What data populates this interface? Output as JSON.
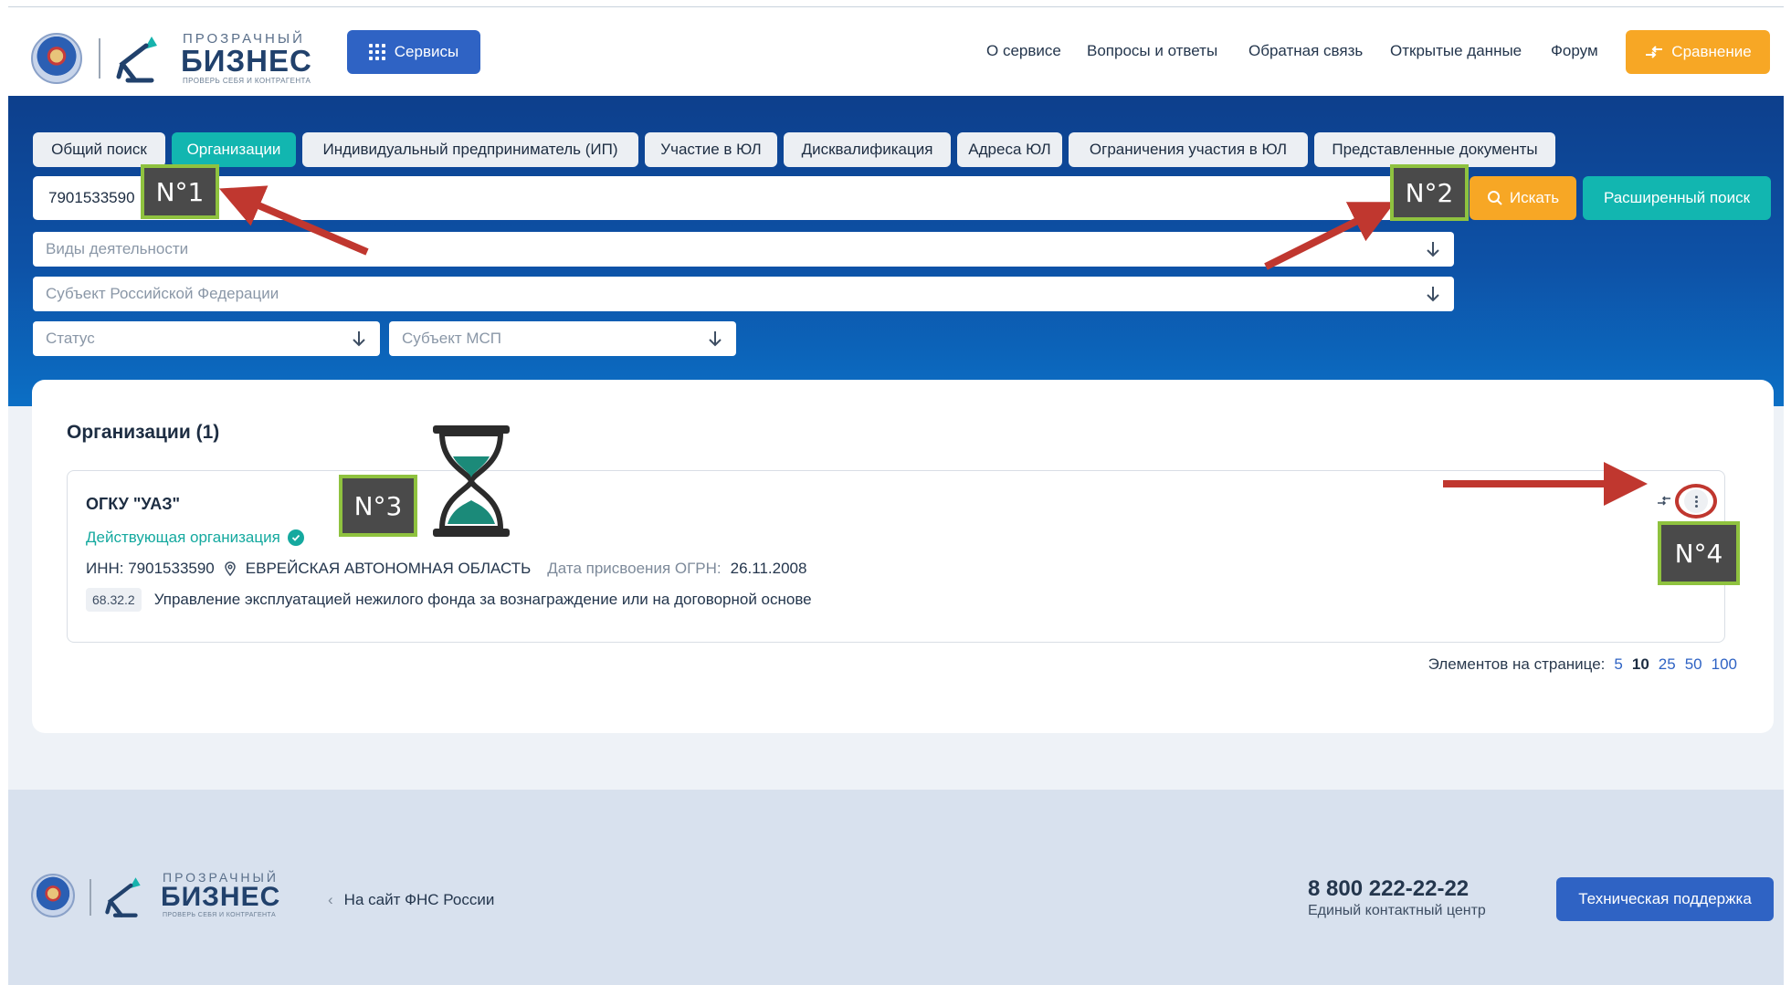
{
  "header": {
    "logo": {
      "top": "ПРОЗРАЧНЫЙ",
      "main": "БИЗНЕС",
      "sub": "ПРОВЕРЬ СЕБЯ И КОНТРАГЕНТА"
    },
    "services_label": "Сервисы",
    "nav": [
      "О сервисе",
      "Вопросы и ответы",
      "Обратная связь",
      "Открытые данные",
      "Форум"
    ],
    "compare_label": "Сравнение"
  },
  "tabs": [
    {
      "label": "Общий поиск",
      "active": false
    },
    {
      "label": "Организации",
      "active": true
    },
    {
      "label": "Индивидуальный предприниматель (ИП)",
      "active": false
    },
    {
      "label": "Участие в ЮЛ",
      "active": false
    },
    {
      "label": "Дисквалификация",
      "active": false
    },
    {
      "label": "Адреса ЮЛ",
      "active": false
    },
    {
      "label": "Ограничения участия в ЮЛ",
      "active": false
    },
    {
      "label": "Представленные документы",
      "active": false
    }
  ],
  "search": {
    "value": "7901533590",
    "find_label": "Искать",
    "advanced_label": "Расширенный поиск"
  },
  "filters": {
    "activity": "Виды деятельности",
    "region": "Субъект Российской Федерации",
    "status": "Статус",
    "msp": "Субъект МСП"
  },
  "results": {
    "title": "Организации (1)",
    "item": {
      "name": "ОГКУ \"УАЗ\"",
      "status": "Действующая организация",
      "inn": "ИНН: 7901533590",
      "region": "ЕВРЕЙСКАЯ АВТОНОМНАЯ ОБЛАСТЬ",
      "ogrn_label": "Дата присвоения ОГРН:",
      "ogrn_date": "26.11.2008",
      "okved_code": "68.32.2",
      "okved_text": "Управление эксплуатацией нежилого фонда за вознаграждение или на договорной основе"
    },
    "pager": {
      "label": "Элементов на странице:",
      "options": [
        "5",
        "10",
        "25",
        "50",
        "100"
      ],
      "selected": "10"
    }
  },
  "footer": {
    "logo": {
      "top": "ПРОЗРАЧНЫЙ",
      "main": "БИЗНЕС",
      "sub": "ПРОВЕРЬ СЕБЯ И КОНТРАГЕНТА"
    },
    "fns_link": "На сайт ФНС России",
    "phone": "8 800 222-22-22",
    "phone_sub": "Единый контактный центр",
    "support_label": "Техническая поддержка"
  },
  "annotations": {
    "badge1": "N°1",
    "badge2": "N°2",
    "badge3": "N°3",
    "badge4": "N°4"
  },
  "colors": {
    "brand_blue": "#2f63c4",
    "accent_orange": "#f7a725",
    "teal": "#12b6b0",
    "arrow_red": "#c0372f",
    "badge_green": "#8fc23f"
  }
}
